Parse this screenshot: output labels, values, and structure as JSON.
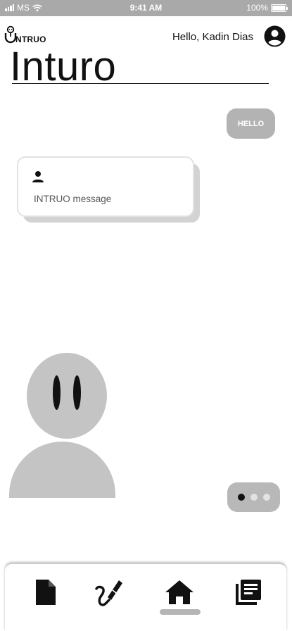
{
  "status_bar": {
    "carrier": "MS",
    "time": "9:41 AM",
    "battery": "100%",
    "battery_level": 1.0
  },
  "header": {
    "logo_text": "NTRUO",
    "greeting": "Hello, Kadin Dias",
    "page_title": "Inturo"
  },
  "chat": {
    "user_message": "HELLO",
    "bot_message": "INTRUO message"
  },
  "typing_indicator": {
    "active_index": 0,
    "dot_count": 3
  },
  "bottom_nav": {
    "items": [
      {
        "icon": "document-icon"
      },
      {
        "icon": "brush-icon"
      },
      {
        "icon": "home-icon",
        "selected": true
      },
      {
        "icon": "library-icon"
      }
    ]
  }
}
